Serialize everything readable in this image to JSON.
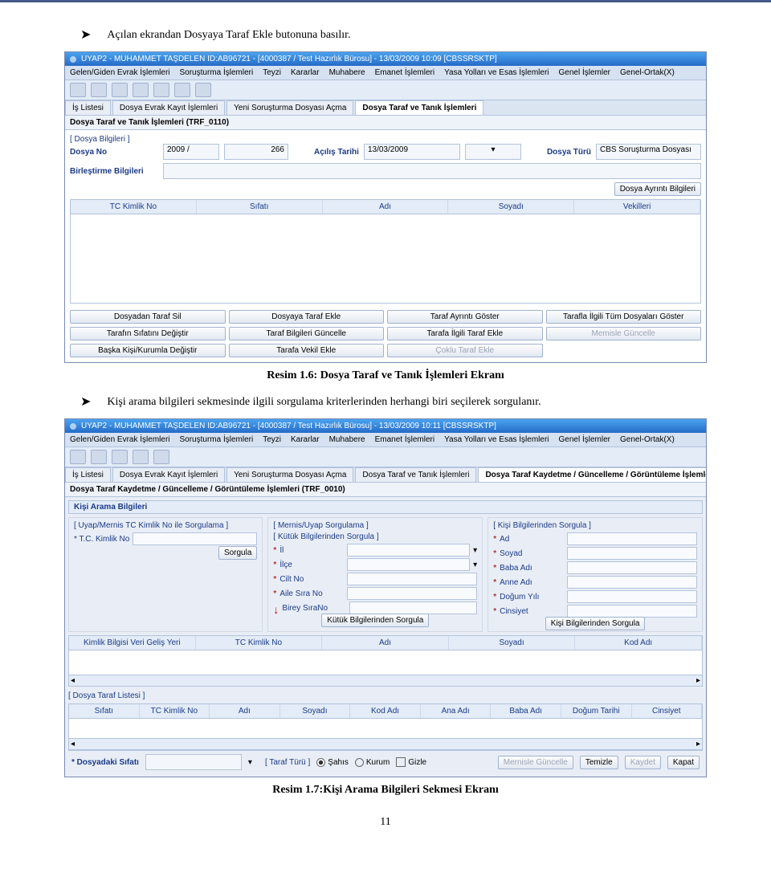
{
  "doc": {
    "bullet1": "Açılan ekrandan Dosyaya Taraf Ekle butonuna basılır.",
    "caption1": "Resim 1.6: Dosya Taraf ve Tanık İşlemleri Ekranı",
    "bullet2": "Kişi arama bilgileri sekmesinde ilgili sorgulama kriterlerinden herhangi biri seçilerek sorgulanır.",
    "caption2": "Resim 1.7:Kişi Arama Bilgileri Sekmesi Ekranı",
    "page_number": "11"
  },
  "app1": {
    "title": "UYAP2 - MUHAMMET TAŞDELEN   ID:AB96721 - [4000387 / Test Hazırlık Bürosu] - 13/03/2009 10:09 [CBSSRSKTP]",
    "menus": [
      "Gelen/Giden Evrak İşlemleri",
      "Soruşturma İşlemleri",
      "Teyzi",
      "Kararlar",
      "Muhabere",
      "Emanet İşlemleri",
      "Yasa Yolları ve Esas İşlemleri",
      "Genel İşlemler",
      "Genel-Ortak(X)"
    ],
    "tabs": [
      "İş Listesi",
      "Dosya Evrak Kayıt İşlemleri",
      "Yeni Soruşturma Dosyası Açma",
      "Dosya Taraf ve Tanık İşlemleri"
    ],
    "active_tab": 3,
    "sub_header": "Dosya Taraf ve Tanık İşlemleri (TRF_0110)",
    "group_title": "[ Dosya Bilgileri ]",
    "labels": {
      "dosya_no": "Dosya No",
      "acilis_tarihi": "Açılış Tarihi",
      "dosya_turu": "Dosya Türü",
      "birlestirme": "Birleştirme Bilgileri",
      "dosya_ayrinti_btn": "Dosya Ayrıntı Bilgileri"
    },
    "values": {
      "dosya_no_y": "2009 /",
      "dosya_no_n": "266",
      "acilis_tarihi": "13/03/2009",
      "dosya_turu": "CBS Soruşturma Dosyası"
    },
    "columns": [
      "TC Kimlik No",
      "Sıfatı",
      "Adı",
      "Soyadı",
      "Vekilleri"
    ],
    "buttons": [
      "Dosyadan Taraf Sil",
      "Dosyaya Taraf Ekle",
      "Taraf Ayrıntı Göster",
      "Tarafla İlgili Tüm Dosyaları Göster",
      "Tarafın Sıfatını Değiştir",
      "Taraf Bilgileri  Güncelle",
      "Tarafa İlgili Taraf Ekle",
      "Memisle Güncelle",
      "Başka Kişi/Kurumla Değiştir",
      "Tarafa Vekil Ekle",
      "Çoklu Taraf Ekle",
      ""
    ]
  },
  "app2": {
    "title": "UYAP2 - MUHAMMET TAŞDELEN   ID:AB96721 - [4000387 / Test Hazırlık Bürosu] - 13/03/2009 10:11 [CBSSRSKTP]",
    "menus": [
      "Gelen/Giden Evrak İşlemleri",
      "Soruşturma İşlemleri",
      "Teyzi",
      "Kararlar",
      "Muhabere",
      "Emanet İşlemleri",
      "Yasa Yolları ve Esas İşlemleri",
      "Genel İşlemler",
      "Genel-Ortak(X)"
    ],
    "tabs": [
      "İş Listesi",
      "Dosya Evrak Kayıt İşlemleri",
      "Yeni Soruşturma Dosyası Açma",
      "Dosya Taraf ve Tanık İşlemleri",
      "Dosya Taraf Kaydetme / Güncelleme / Görüntüleme İşlemleri"
    ],
    "active_tab": 4,
    "sub_header": "Dosya Taraf Kaydetme / Güncelleme / Görüntüleme İşlemleri (TRF_0010)",
    "panel": "Kişi Arama Bilgileri",
    "group1": {
      "title": "[ Uyap/Mernis TC Kimlik No ile Sorgulama ]",
      "label_tc": "* T.C. Kimlik No",
      "btn": "Sorgula"
    },
    "group2": {
      "title": "[ Mernis/Uyap Sorgulama ]",
      "sub": "[ Kütük Bilgilerinden Sorgula ]",
      "fields": [
        "İl",
        "İlçe",
        "Cilt No",
        "Aile Sıra No",
        "Birey SıraNo"
      ],
      "btn": "Kütük Bilgilerinden Sorgula"
    },
    "group3": {
      "title": "[ Kişi Bilgilerinden Sorgula ]",
      "fields": [
        "Ad",
        "Soyad",
        "Baba Adı",
        "Anne Adı",
        "Doğum Yılı",
        "Cinsiyet"
      ],
      "btn": "Kişi Bilgilerinden Sorgula"
    },
    "grid_a_cols": [
      "Kimlik Bilgisi Veri Geliş Yeri",
      "TC Kimlik No",
      "Adı",
      "Soyadı",
      "Kod Adı"
    ],
    "list_title": "[ Dosya Taraf Listesi ]",
    "grid_b_cols": [
      "Sıfatı",
      "TC Kimlik No",
      "Adı",
      "Soyadı",
      "Kod Adı",
      "Ana Adı",
      "Baba Adı",
      "Doğum Tarihi",
      "Cinsiyet"
    ],
    "bottom": {
      "sifat_label": "* Dosyadaki Sıfatı",
      "taraf_turu": "[ Taraf Türü ]",
      "opt_sahis": "Şahıs",
      "opt_kurum": "Kurum",
      "opt_gizle": "Gizle",
      "btns": [
        "Mernisle Güncelle",
        "Temizle",
        "Kaydet",
        "Kapat"
      ]
    }
  }
}
